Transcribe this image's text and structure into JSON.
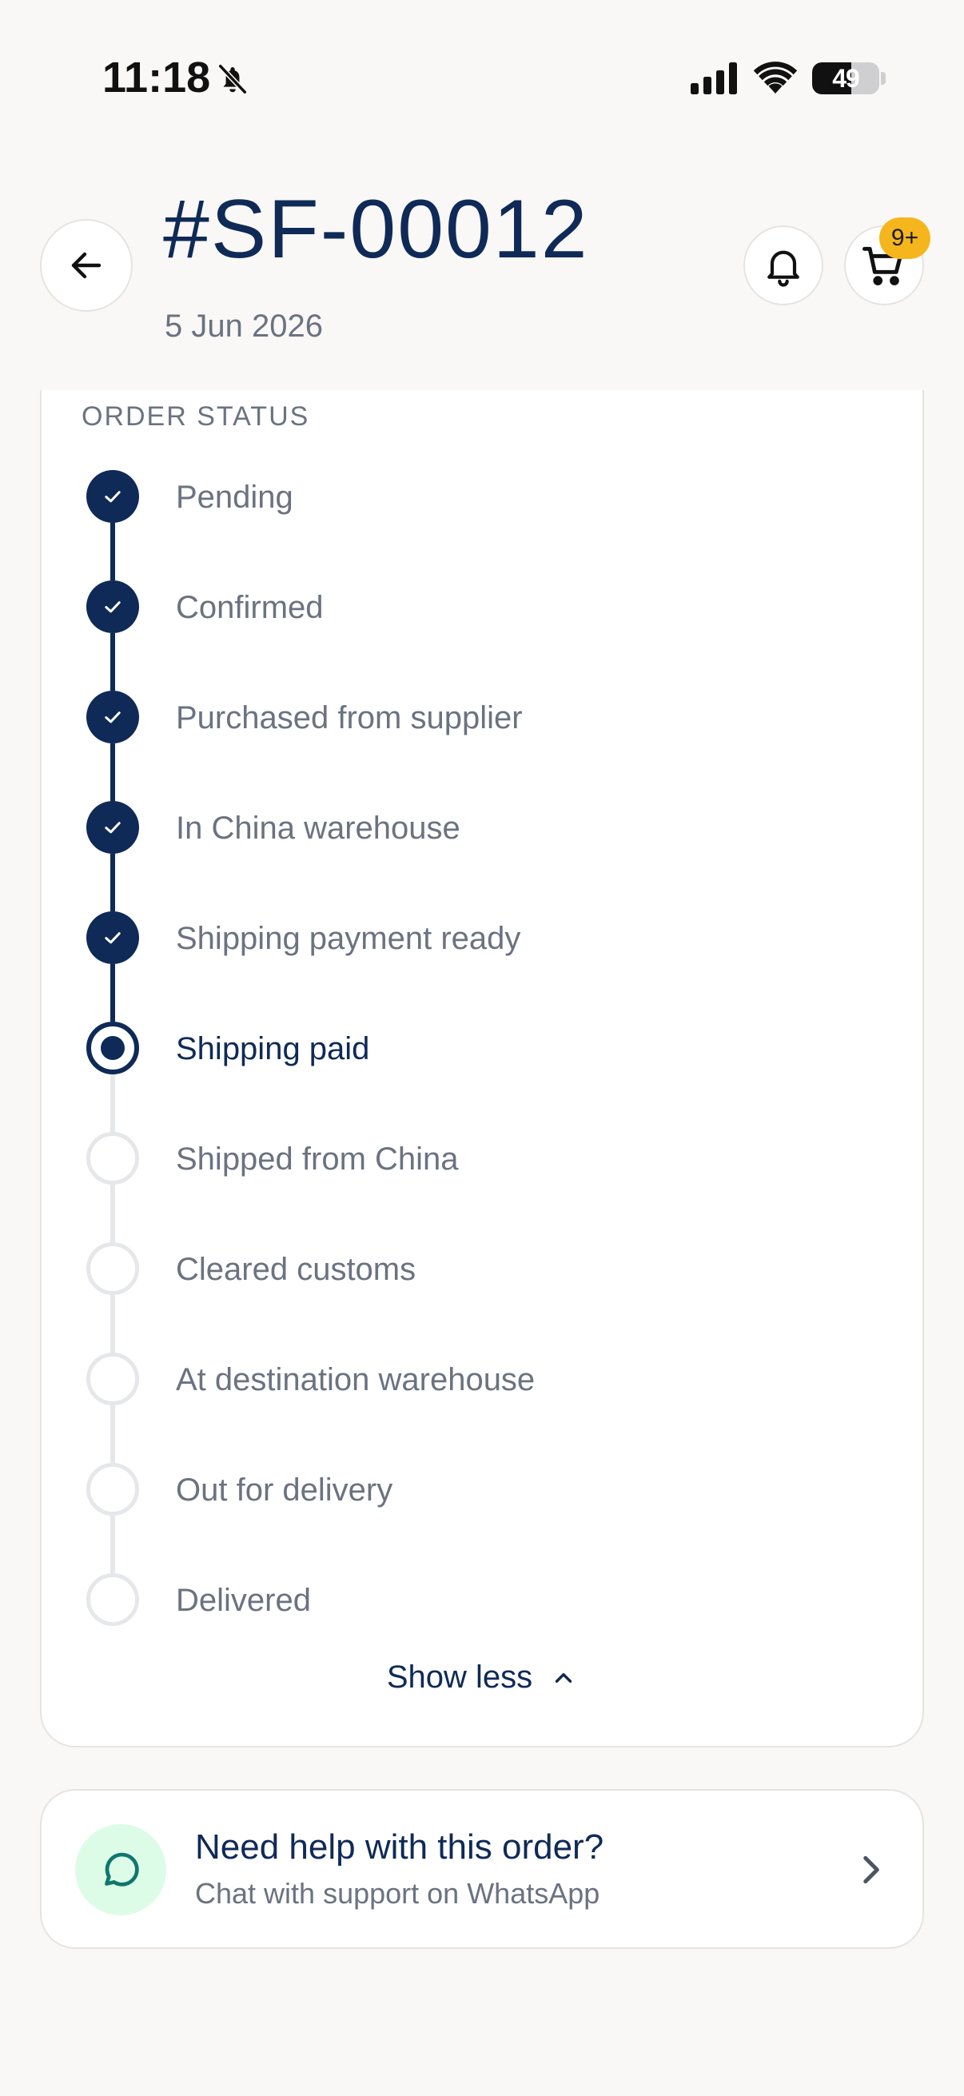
{
  "status_bar": {
    "time": "11:18",
    "battery": "49",
    "icons": [
      "bell-slash-icon",
      "signal-icon",
      "wifi-icon",
      "battery-icon"
    ]
  },
  "header": {
    "order_id": "#SF-00012",
    "date": "5 Jun 2026",
    "cart_badge": "9+",
    "icons": [
      "arrow-left-icon",
      "bell-icon",
      "cart-icon"
    ]
  },
  "order_status": {
    "section_label": "ORDER STATUS",
    "steps": [
      {
        "label": "Pending",
        "state": "done"
      },
      {
        "label": "Confirmed",
        "state": "done"
      },
      {
        "label": "Purchased from supplier",
        "state": "done"
      },
      {
        "label": "In China warehouse",
        "state": "done"
      },
      {
        "label": "Shipping payment ready",
        "state": "done"
      },
      {
        "label": "Shipping paid",
        "state": "current"
      },
      {
        "label": "Shipped from China",
        "state": "todo"
      },
      {
        "label": "Cleared customs",
        "state": "todo"
      },
      {
        "label": "At destination warehouse",
        "state": "todo"
      },
      {
        "label": "Out for delivery",
        "state": "todo"
      },
      {
        "label": "Delivered",
        "state": "todo"
      }
    ],
    "toggle_label": "Show less"
  },
  "help": {
    "title": "Need help with this order?",
    "subtitle": "Chat with support on WhatsApp"
  },
  "colors": {
    "navy": "#0f2a57",
    "muted": "#6b7280",
    "badge": "#f5b51c",
    "help_bg": "#dcfce7",
    "help_icon": "#0f766e"
  }
}
